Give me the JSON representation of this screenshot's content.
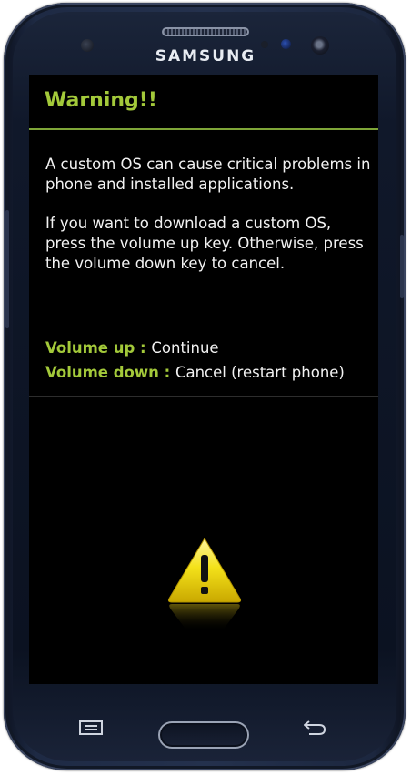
{
  "device": {
    "brand": "SAMSUNG"
  },
  "dialog": {
    "title": "Warning!!",
    "paragraph1": "A custom OS can cause critical problems in phone and installed applications.",
    "paragraph2": "If you want to download a custom OS, press the volume up key. Otherwise, press the volume down key to cancel.",
    "options": [
      {
        "key": "Volume up",
        "separator": " : ",
        "action": "Continue"
      },
      {
        "key": "Volume down",
        "separator": " : ",
        "action": "Cancel (restart phone)"
      }
    ]
  },
  "icons": {
    "warning": "warning-triangle-icon",
    "menu": "menu-icon",
    "back": "back-icon"
  },
  "colors": {
    "accent": "#a3c93a",
    "screen_bg": "#000000",
    "text": "#f2f2f2",
    "warning_yellow": "#f4e21a"
  }
}
